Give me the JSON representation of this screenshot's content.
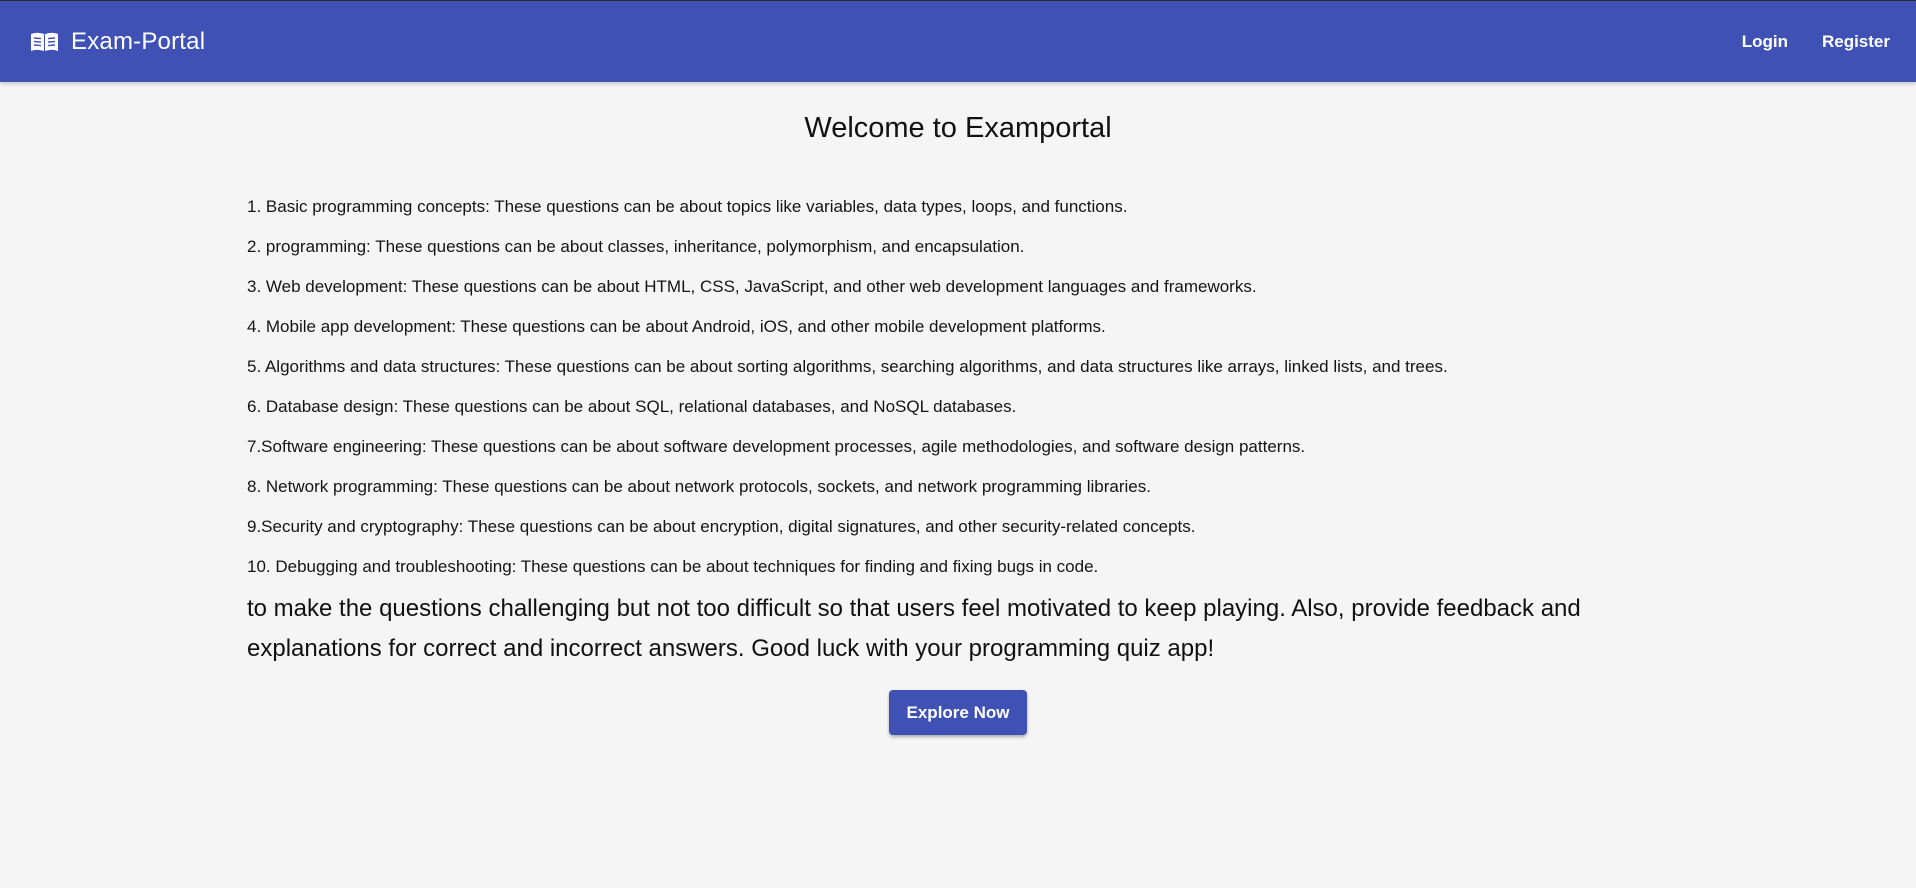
{
  "navbar": {
    "brand_icon": "open-book-icon",
    "brand_title": "Exam-Portal",
    "links": [
      {
        "label": "Login"
      },
      {
        "label": "Register"
      }
    ],
    "color": "#3f51b5"
  },
  "main": {
    "heading": "Welcome to Examportal",
    "topics": [
      "1. Basic programming concepts: These questions can be about topics like variables, data types, loops, and functions.",
      "2. programming: These questions can be about classes, inheritance, polymorphism, and encapsulation.",
      "3. Web development: These questions can be about HTML, CSS, JavaScript, and other web development languages and frameworks.",
      "4. Mobile app development: These questions can be about Android, iOS, and other mobile development platforms.",
      "5. Algorithms and data structures: These questions can be about sorting algorithms, searching algorithms, and data structures like arrays, linked lists, and trees.",
      "6. Database design: These questions can be about SQL, relational databases, and NoSQL databases.",
      "7.Software engineering: These questions can be about software development processes, agile methodologies, and software design patterns.",
      "8. Network programming: These questions can be about network protocols, sockets, and network programming libraries.",
      "9.Security and cryptography: These questions can be about encryption, digital signatures, and other security-related concepts.",
      "10. Debugging and troubleshooting: These questions can be about techniques for finding and fixing bugs in code."
    ],
    "closing_text": "to make the questions challenging but not too difficult so that users feel motivated to keep playing. Also, provide feedback and explanations for correct and incorrect answers. Good luck with your programming quiz app!",
    "cta_label": "Explore Now"
  }
}
